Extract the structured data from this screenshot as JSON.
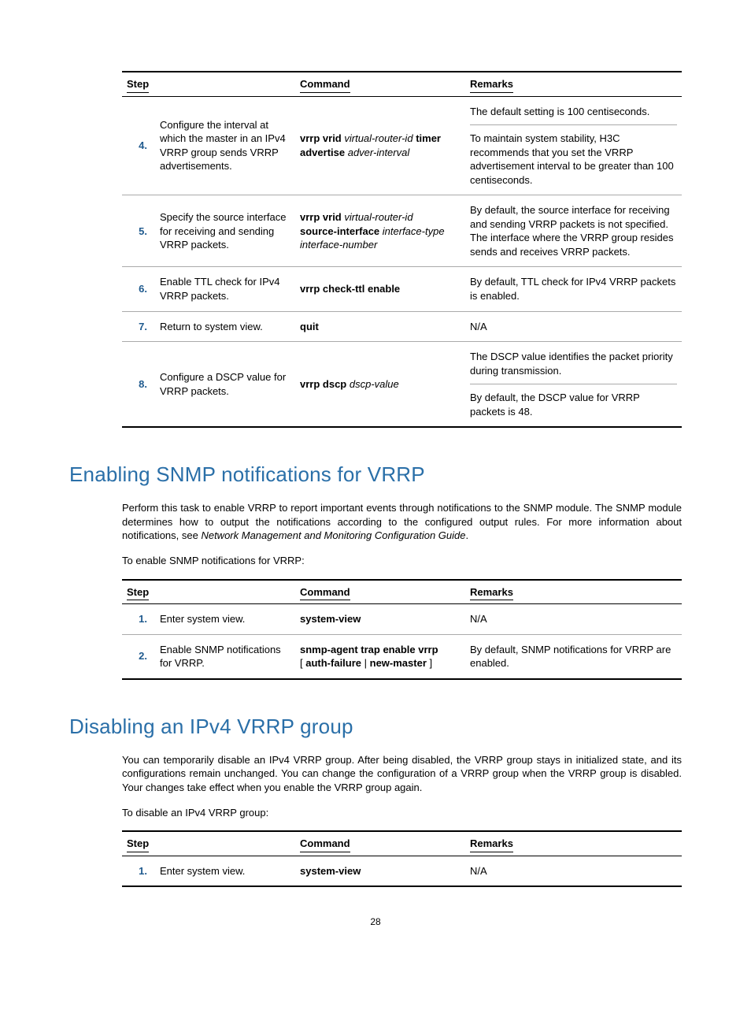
{
  "table1": {
    "headers": {
      "step": "Step",
      "command": "Command",
      "remarks": "Remarks"
    },
    "rows": [
      {
        "num": "4.",
        "desc": "Configure the interval at which the master in an IPv4 VRRP group sends VRRP advertisements.",
        "cmd_b1": "vrrp vrid",
        "cmd_i1": "virtual-router-id",
        "cmd_b2": "timer advertise",
        "cmd_i2": "adver-interval",
        "rem1": "The default setting is 100 centiseconds.",
        "rem2": "To maintain system stability, H3C recommends that you set the VRRP advertisement interval to be greater than 100 centiseconds."
      },
      {
        "num": "5.",
        "desc": "Specify the source interface for receiving and sending VRRP packets.",
        "cmd_b1": "vrrp vrid",
        "cmd_i1": "virtual-router-id",
        "cmd_b2": "source-interface",
        "cmd_i2": "interface-type interface-number",
        "rem": "By default, the source interface for receiving and sending VRRP packets is not specified. The interface where the VRRP group resides sends and receives VRRP packets."
      },
      {
        "num": "6.",
        "desc": "Enable TTL check for IPv4 VRRP packets.",
        "cmd_b": "vrrp check-ttl enable",
        "rem": "By default, TTL check for IPv4 VRRP packets is enabled."
      },
      {
        "num": "7.",
        "desc": "Return to system view.",
        "cmd_b": "quit",
        "rem": "N/A"
      },
      {
        "num": "8.",
        "desc": "Configure a DSCP value for VRRP packets.",
        "cmd_b1": "vrrp dscp",
        "cmd_i1": "dscp-value",
        "rem1": "The DSCP value identifies the packet priority during transmission.",
        "rem2": "By default, the DSCP value for VRRP packets is 48."
      }
    ]
  },
  "section1": {
    "heading": "Enabling SNMP notifications for VRRP",
    "para1a": "Perform this task to enable VRRP to report important events through notifications to the SNMP module. The SNMP module determines how to output the notifications according to the configured output rules. For more information about notifications, see ",
    "para1i": "Network Management and Monitoring Configuration Guide",
    "para1b": ".",
    "para2": "To enable SNMP notifications for VRRP:"
  },
  "table2": {
    "headers": {
      "step": "Step",
      "command": "Command",
      "remarks": "Remarks"
    },
    "rows": [
      {
        "num": "1.",
        "desc": "Enter system view.",
        "cmd_b": "system-view",
        "rem": "N/A"
      },
      {
        "num": "2.",
        "desc": "Enable SNMP notifications for VRRP.",
        "cmd_b1": "snmp-agent trap enable vrrp",
        "cmd_p2": "[ ",
        "cmd_b2": "auth-failure",
        "cmd_p3": " | ",
        "cmd_b3": "new-master",
        "cmd_p4": " ]",
        "rem": "By default, SNMP notifications for VRRP are enabled."
      }
    ]
  },
  "section2": {
    "heading": "Disabling an IPv4 VRRP group",
    "para1": "You can temporarily disable an IPv4 VRRP group. After being disabled, the VRRP group stays in initialized state, and its configurations remain unchanged. You can change the configuration of a VRRP group when the VRRP group is disabled. Your changes take effect when you enable the VRRP group again.",
    "para2": "To disable an IPv4 VRRP group:"
  },
  "table3": {
    "headers": {
      "step": "Step",
      "command": "Command",
      "remarks": "Remarks"
    },
    "rows": [
      {
        "num": "1.",
        "desc": "Enter system view.",
        "cmd_b": "system-view",
        "rem": "N/A"
      }
    ]
  },
  "page_number": "28"
}
